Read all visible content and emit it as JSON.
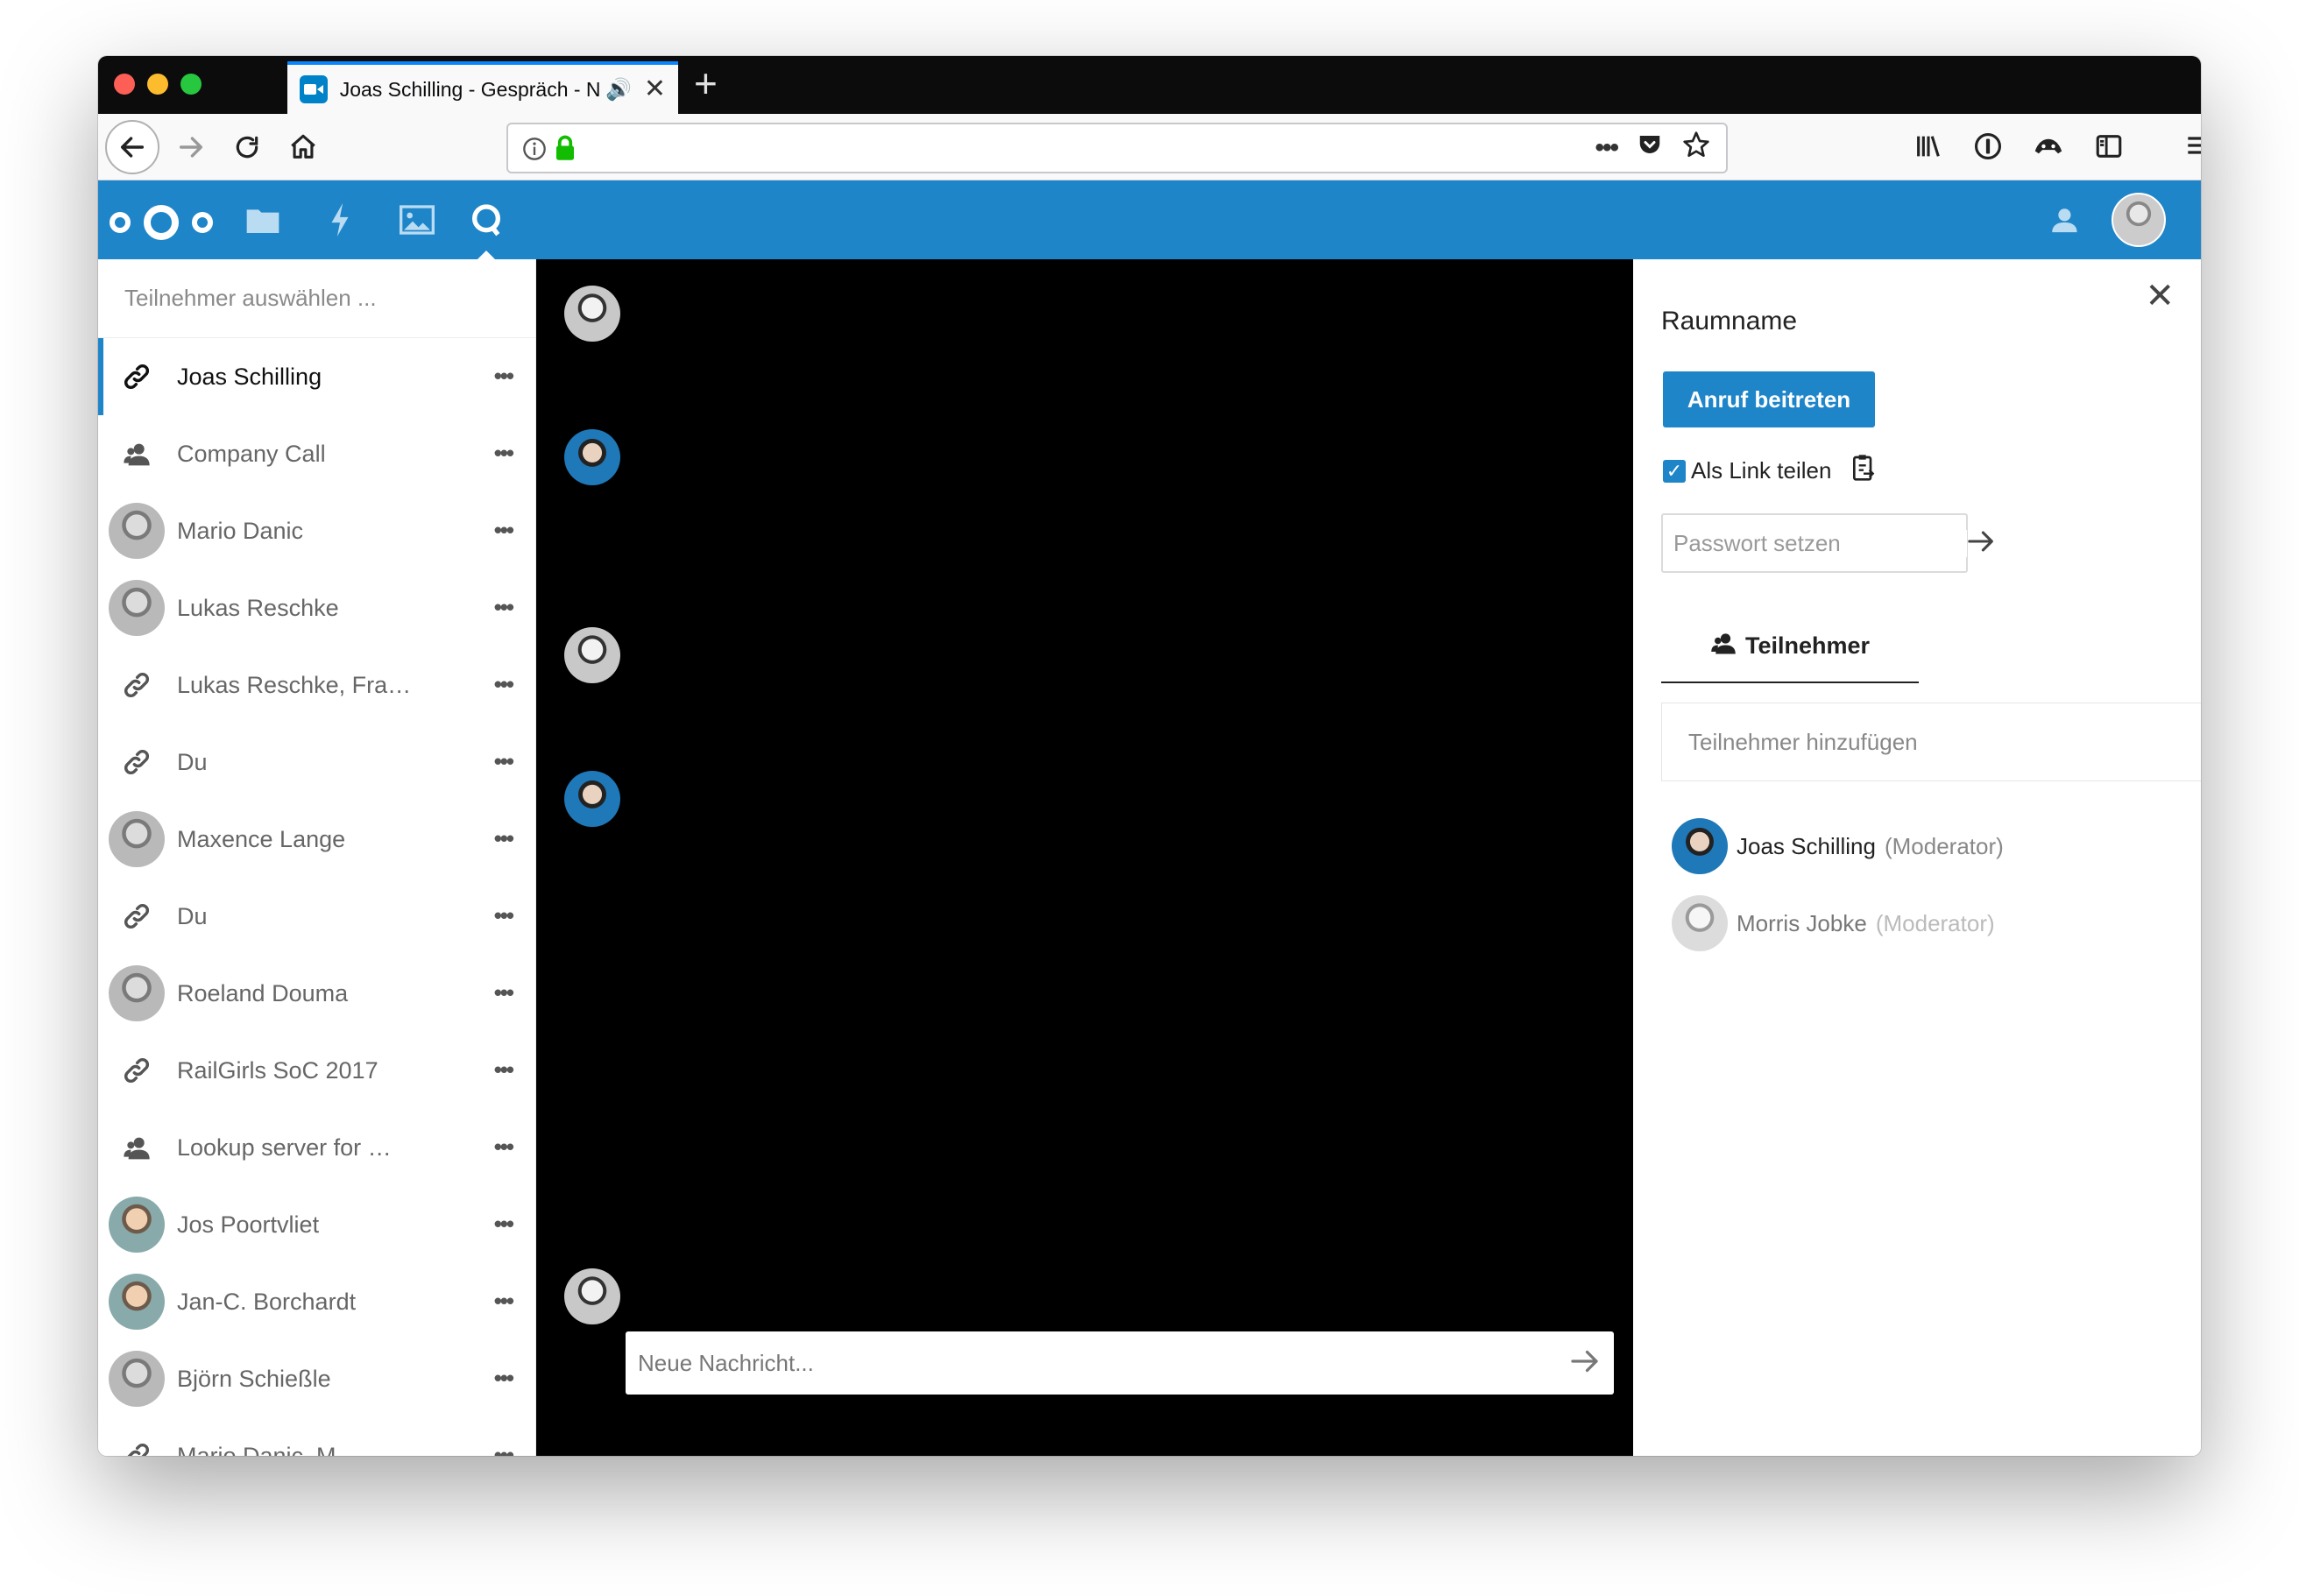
{
  "browser": {
    "tab_title": "Joas Schilling - Gespräch - Nextcloud",
    "url_value": ""
  },
  "sidebar": {
    "search_placeholder": "Teilnehmer auswählen ...",
    "items": [
      {
        "label": "Joas Schilling",
        "icon": "link-icon",
        "active": true
      },
      {
        "label": "Company Call",
        "icon": "group-icon"
      },
      {
        "label": "Mario Danic",
        "icon": "avatar"
      },
      {
        "label": "Lukas Reschke",
        "icon": "avatar"
      },
      {
        "label": "Lukas Reschke, Fra…",
        "icon": "link-icon"
      },
      {
        "label": "Du",
        "icon": "link-icon"
      },
      {
        "label": "Maxence Lange",
        "icon": "avatar"
      },
      {
        "label": "Du",
        "icon": "link-icon"
      },
      {
        "label": "Roeland Douma",
        "icon": "avatar"
      },
      {
        "label": "RailGirls SoC 2017",
        "icon": "link-icon"
      },
      {
        "label": "Lookup server for …",
        "icon": "group-icon"
      },
      {
        "label": "Jos Poortvliet",
        "icon": "avatar"
      },
      {
        "label": "Jan-C. Borchardt",
        "icon": "avatar"
      },
      {
        "label": "Björn Schießle",
        "icon": "avatar"
      },
      {
        "label": "Mario Danic, M…",
        "icon": "link-icon"
      }
    ]
  },
  "chat": {
    "input_placeholder": "Neue Nachricht..."
  },
  "details": {
    "room_name": "Raumname",
    "join_button": "Anruf beitreten",
    "share_link_label": "Als Link teilen",
    "password_placeholder": "Passwort setzen",
    "tab_label": "Teilnehmer",
    "add_participant_placeholder": "Teilnehmer hinzufügen",
    "participants": [
      {
        "name": "Joas Schilling",
        "role": "(Moderator)"
      },
      {
        "name": "Morris Jobke",
        "role": "(Moderator)"
      }
    ]
  },
  "colors": {
    "brand": "#1e85c9",
    "video_bg": "#000000"
  }
}
